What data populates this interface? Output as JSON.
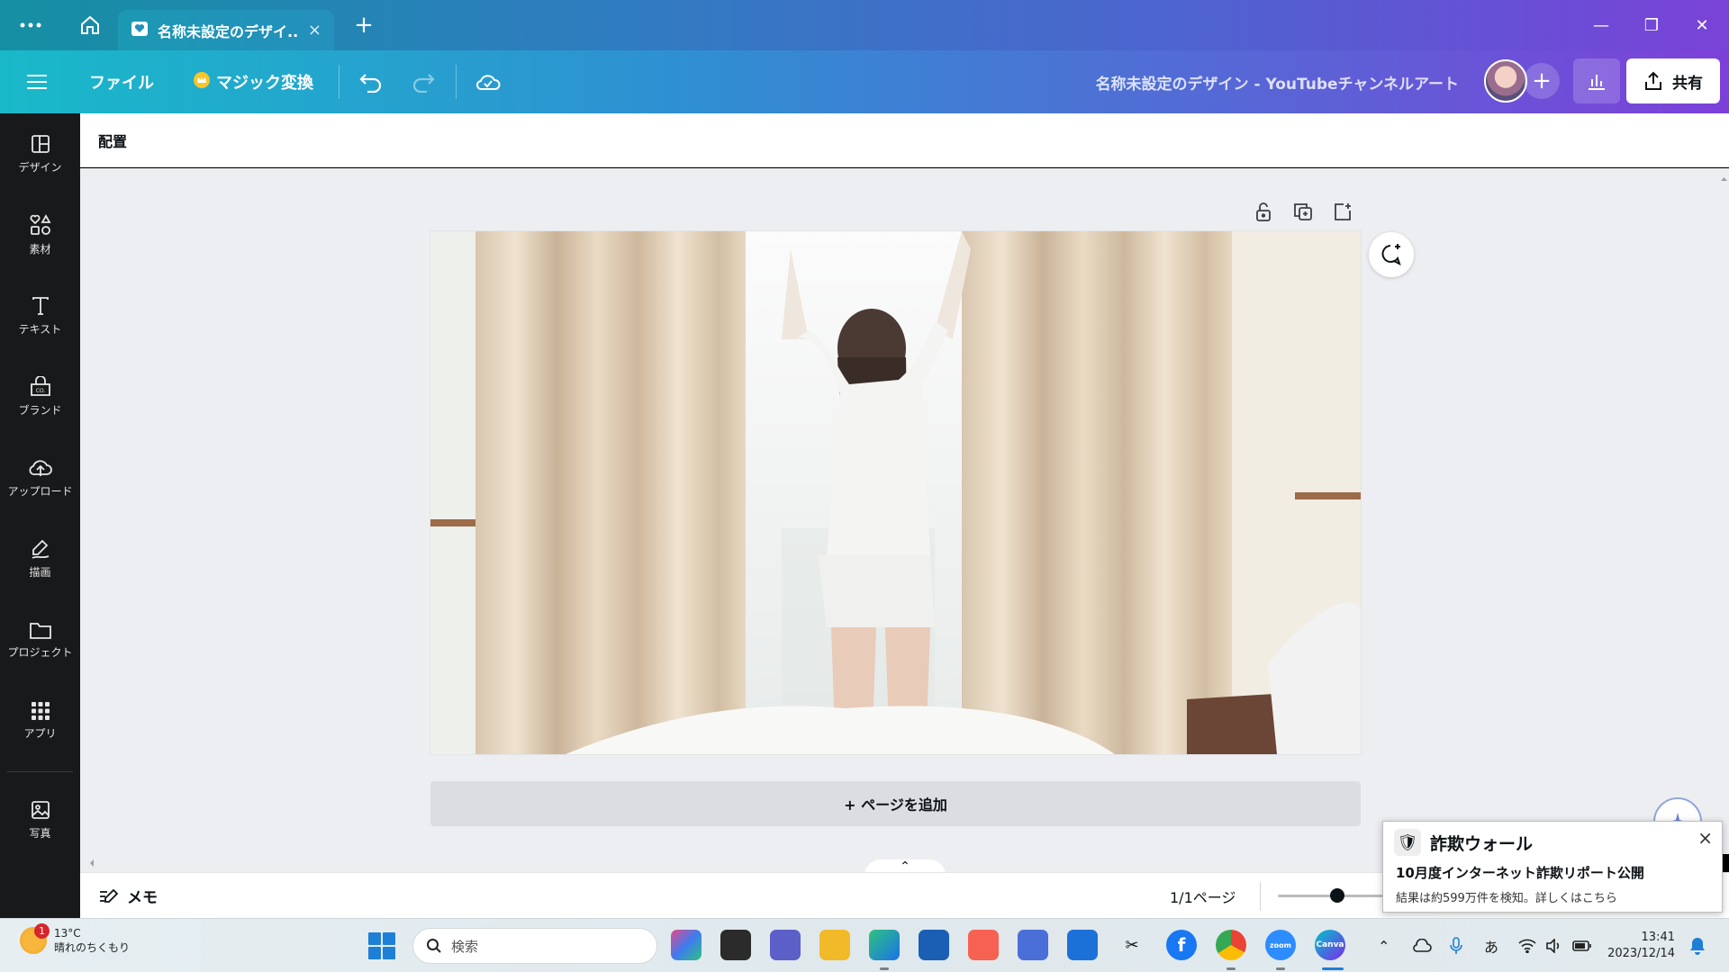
{
  "browser": {
    "tab_title": "名称未設定のデザイ...",
    "tab_close": "×",
    "new_tab": "+",
    "window_minimize": "—",
    "window_restore": "❐",
    "window_close": "✕"
  },
  "toolbar": {
    "file_label": "ファイル",
    "magic_label": "マジック変換",
    "document_title": "名称未設定のデザイン - YouTubeチャンネルアート",
    "add_label": "+",
    "share_label": "共有"
  },
  "sidebar": {
    "items": [
      {
        "label": "デザイン",
        "icon": "design-icon"
      },
      {
        "label": "素材",
        "icon": "elements-icon"
      },
      {
        "label": "テキスト",
        "icon": "text-icon"
      },
      {
        "label": "ブランド",
        "icon": "brand-icon"
      },
      {
        "label": "アップロード",
        "icon": "upload-icon"
      },
      {
        "label": "描画",
        "icon": "draw-icon"
      },
      {
        "label": "プロジェクト",
        "icon": "projects-icon"
      },
      {
        "label": "アプリ",
        "icon": "apps-icon"
      },
      {
        "label": "写真",
        "icon": "photos-icon"
      }
    ]
  },
  "context_bar": {
    "arrange_label": "配置"
  },
  "canvas": {
    "add_page_label": "+ ページを追加",
    "collapse_symbol": "⌃"
  },
  "footer": {
    "memo_label": "メモ",
    "page_indicator": "1/1ページ",
    "zoom_level": 0.55
  },
  "notification": {
    "app_name": "詐欺ウォール",
    "close": "×",
    "line1": "10月度インターネット詐欺リポート公開",
    "line2": "結果は約599万件を検知。詳しくはこちら"
  },
  "taskbar": {
    "weather_temp": "13°C",
    "weather_desc": "晴れのちくもり",
    "weather_badge": "1",
    "search_placeholder": "検索",
    "ime_label": "あ",
    "time": "13:41",
    "date": "2023/12/14"
  },
  "colors": {
    "canva_accent": "#7d2ae8",
    "sidebar_bg": "#18191b",
    "canvas_bg": "#eceef1"
  }
}
